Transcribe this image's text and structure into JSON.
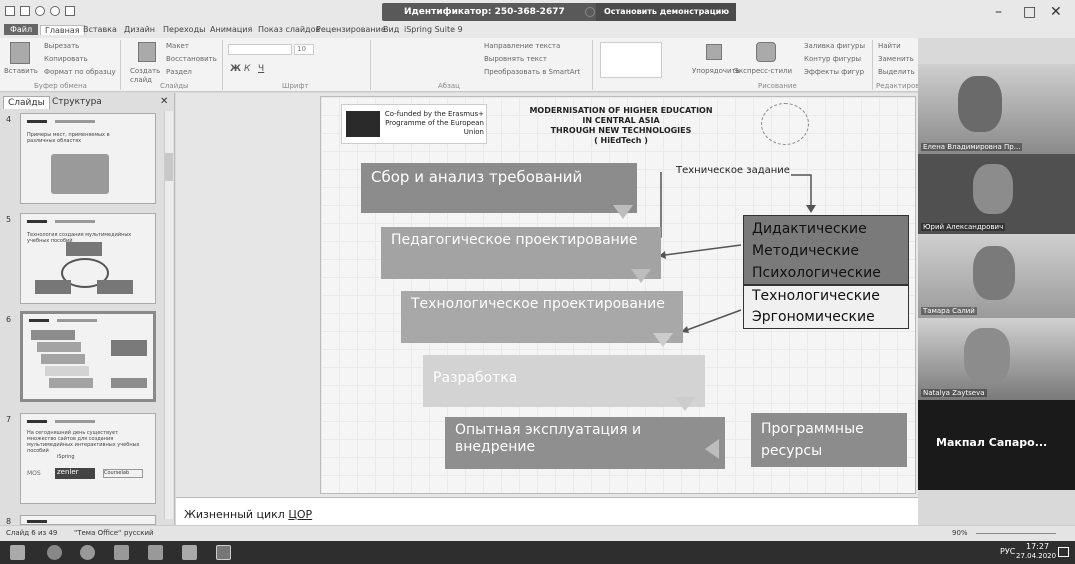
{
  "titlebar": {
    "meeting_id": "Идентификатор: 250-368-2677",
    "stop_demo": "Остановить демонстрацию",
    "minimize": "–",
    "maximize": "□",
    "close": "✕"
  },
  "ribbon_tabs": [
    "Файл",
    "Главная",
    "Вставка",
    "Дизайн",
    "Переходы",
    "Анимация",
    "Показ слайдов",
    "Рецензирование",
    "Вид",
    "iSpring Suite 9"
  ],
  "ribbon": {
    "clipboard": {
      "paste": "Вставить",
      "cut": "Вырезать",
      "copy": "Копировать",
      "format_painter": "Формат по образцу",
      "label": "Буфер обмена"
    },
    "slides": {
      "new_slide": "Создать слайд",
      "layout": "Макет",
      "reset": "Восстановить",
      "section": "Раздел",
      "label": "Слайды"
    },
    "font": {
      "size": "10",
      "label": "Шрифт"
    },
    "paragraph": {
      "text_direction": "Направление текста",
      "align_text": "Выровнять текст",
      "smartart": "Преобразовать в SmartArt",
      "label": "Абзац"
    },
    "drawing": {
      "arrange": "Упорядочить",
      "quick_styles": "Экспресс-стили",
      "fill": "Заливка фигуры",
      "outline": "Контур фигуры",
      "effects": "Эффекты фигур",
      "label": "Рисование"
    },
    "editing": {
      "find": "Найти",
      "replace": "Заменить",
      "select": "Выделить",
      "label": "Редактиров"
    }
  },
  "left_panel": {
    "tabs": [
      "Слайды",
      "Структура"
    ],
    "close": "✕",
    "thumbnails": [
      {
        "number": "4",
        "text": "Примеры мест, применяемых в различных областях"
      },
      {
        "number": "5",
        "text": "Технология создания мультимедийных учебных пособий"
      },
      {
        "number": "6",
        "text": ""
      },
      {
        "number": "7",
        "text": "На сегодняшний день существует множество сайтов для создания мультимедийных интерактивных учебных пособий",
        "logos": [
          "MOS",
          "zenler",
          "iSpring",
          "Courselab"
        ]
      },
      {
        "number": "8",
        "text": ""
      }
    ]
  },
  "slide": {
    "header_left": "Co-funded by the Erasmus+ Programme of the European Union",
    "header_title_l1": "MODERNISATION OF HIGHER EDUCATION",
    "header_title_l2": "IN CENTRAL ASIA",
    "header_title_l3": "THROUGH NEW TECHNOLOGIES",
    "header_title_l4": "( HiEdTech )",
    "label_tech_task": "Техническое задание",
    "box1": "Сбор и анализ требований",
    "box2": "Педагогическое проектирование",
    "box3": "Технологическое проектирование",
    "box4": "Разработка",
    "box5": "Опытная эксплуатация и внедрение",
    "side1_l1": "Дидактические",
    "side1_l2": "Методические",
    "side1_l3": "Психологические",
    "side2_l1": "Технологические",
    "side2_l2": "Эргономические",
    "side3_l1": "Программные",
    "side3_l2": "ресурсы"
  },
  "notes": {
    "text": "Жизненный цикл ",
    "underlined": "ЦОР"
  },
  "statusbar": {
    "slide_of": "Слайд 6 из 49",
    "theme": "\"Тема Office\"",
    "lang": "русский",
    "zoom": "90%"
  },
  "participants": [
    {
      "name": "Елена Владимировна Пр..."
    },
    {
      "name": "Юрий Александрович"
    },
    {
      "name": "Тамара Салий"
    },
    {
      "name": "Natalya Zaytseva"
    },
    {
      "name": "Макпал Сапаро..."
    }
  ],
  "taskbar": {
    "lang": "РУС",
    "time": "17:27",
    "date": "27.04.2020"
  },
  "colors": {
    "box_dark": "#8c8c8c",
    "box_mid": "#a3a3a3",
    "box_light": "#bdbdbd",
    "box_lightest": "#d3d3d3",
    "side_dark": "#7a7a7a",
    "video_dark": "#1a1a1a"
  }
}
